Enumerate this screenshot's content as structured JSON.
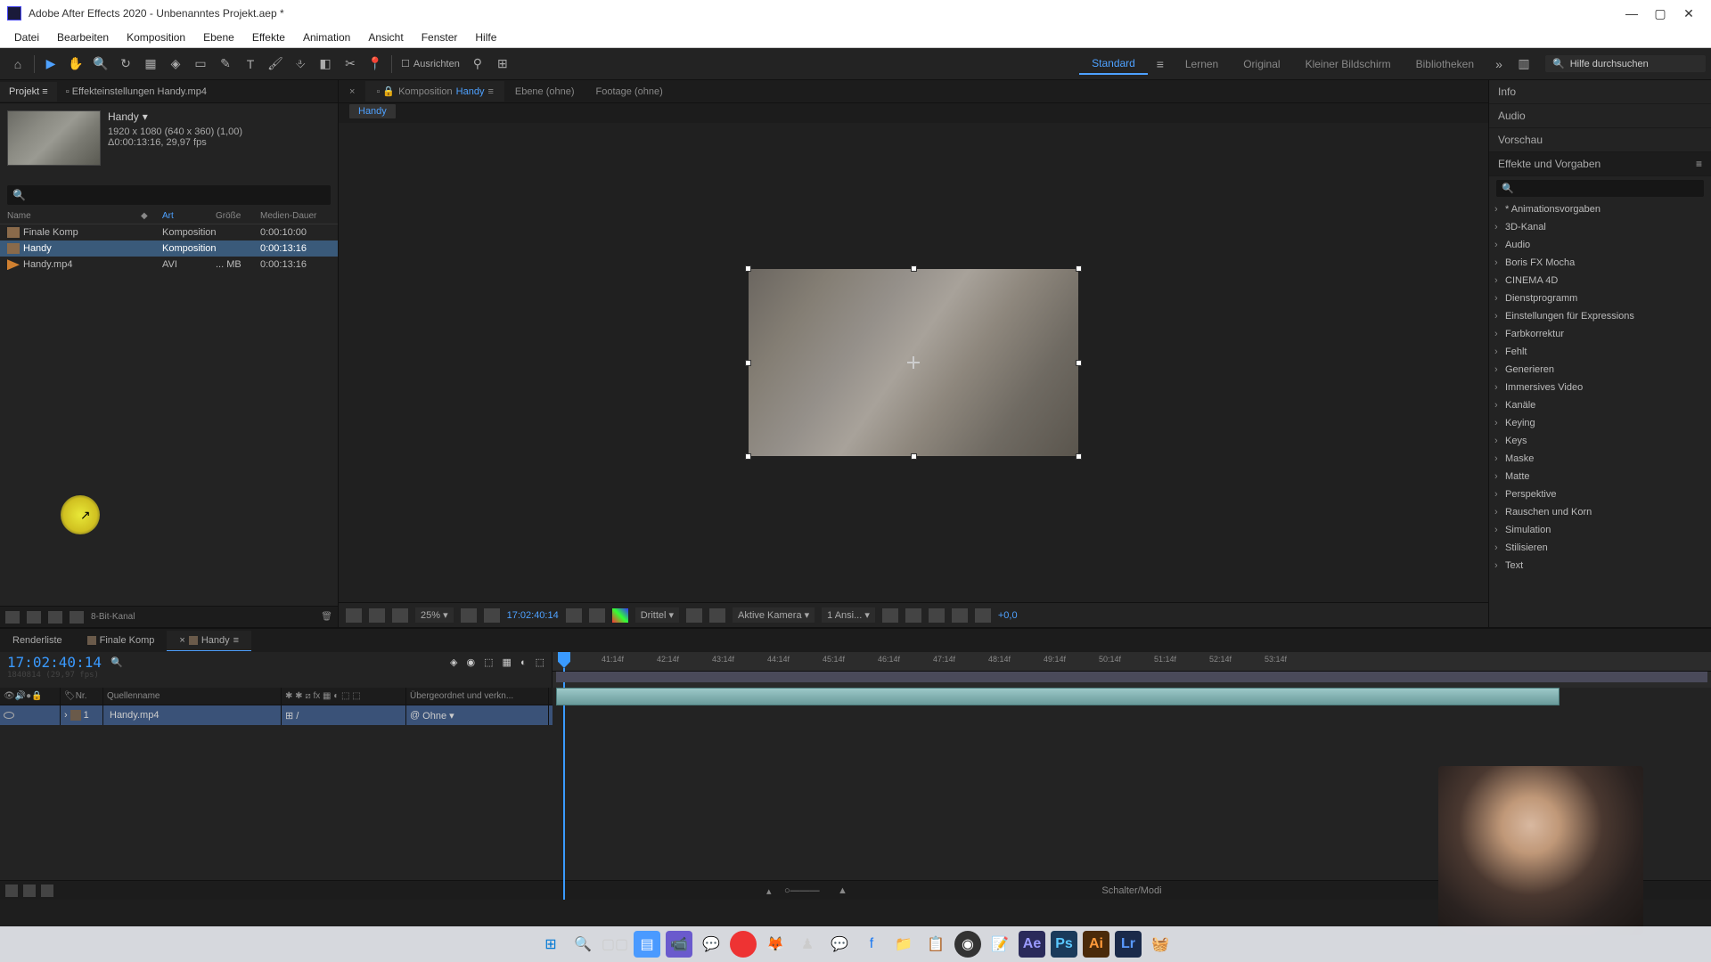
{
  "titlebar": {
    "title": "Adobe After Effects 2020 - Unbenanntes Projekt.aep *"
  },
  "menu": [
    "Datei",
    "Bearbeiten",
    "Komposition",
    "Ebene",
    "Effekte",
    "Animation",
    "Ansicht",
    "Fenster",
    "Hilfe"
  ],
  "toolbar": {
    "snap_label": "Ausrichten",
    "workspaces": [
      "Standard",
      "Lernen",
      "Original",
      "Kleiner Bildschirm",
      "Bibliotheken"
    ],
    "active_ws": "Standard",
    "search_placeholder": "Hilfe durchsuchen"
  },
  "project_panel": {
    "tab_project": "Projekt",
    "tab_effects": "Effekteinstellungen Handy.mp4",
    "selected_name": "Handy",
    "selected_dims": "1920 x 1080 (640 x 360) (1,00)",
    "selected_dur": "Δ0:00:13:16, 29,97 fps",
    "cols": {
      "name": "Name",
      "art": "Art",
      "size": "Größe",
      "dur": "Medien-Dauer"
    },
    "rows": [
      {
        "name": "Finale Komp",
        "art": "Komposition",
        "size": "",
        "dur": "0:00:10:00"
      },
      {
        "name": "Handy",
        "art": "Komposition",
        "size": "",
        "dur": "0:00:13:16",
        "selected": true
      },
      {
        "name": "Handy.mp4",
        "art": "AVI",
        "size": "... MB",
        "dur": "0:00:13:16",
        "video": true
      }
    ],
    "bpc": "8-Bit-Kanal"
  },
  "comp_panel": {
    "tab_comp_prefix": "Komposition",
    "tab_comp_name": "Handy",
    "tab_layer": "Ebene (ohne)",
    "tab_footage": "Footage (ohne)",
    "crumb": "Handy"
  },
  "viewer_bar": {
    "zoom": "25%",
    "timecode": "17:02:40:14",
    "res": "Drittel",
    "camera": "Aktive Kamera",
    "views": "1 Ansi...",
    "exposure": "+0,0"
  },
  "right": {
    "info": "Info",
    "audio": "Audio",
    "preview": "Vorschau",
    "effects_header": "Effekte und Vorgaben",
    "effects": [
      "* Animationsvorgaben",
      "3D-Kanal",
      "Audio",
      "Boris FX Mocha",
      "CINEMA 4D",
      "Dienstprogramm",
      "Einstellungen für Expressions",
      "Farbkorrektur",
      "Fehlt",
      "Generieren",
      "Immersives Video",
      "Kanäle",
      "Keying",
      "Keys",
      "Maske",
      "Matte",
      "Perspektive",
      "Rauschen und Korn",
      "Simulation",
      "Stilisieren",
      "Text"
    ]
  },
  "timeline": {
    "tab_renderlist": "Renderliste",
    "tab_finale": "Finale Komp",
    "tab_handy": "Handy",
    "timecode": "17:02:40:14",
    "subtc": "1840814 (29,97 fps)",
    "ticks": [
      "41:14f",
      "42:14f",
      "43:14f",
      "44:14f",
      "45:14f",
      "46:14f",
      "47:14f",
      "48:14f",
      "49:14f",
      "50:14f",
      "51:14f",
      "52:14f",
      "53:14f"
    ],
    "col_nr": "Nr.",
    "col_src": "Quellenname",
    "col_parent": "Übergeordnet und verkn...",
    "layer_nr": "1",
    "layer_name": "Handy.mp4",
    "parent_value": "Ohne",
    "switches": "Schalter/Modi"
  }
}
